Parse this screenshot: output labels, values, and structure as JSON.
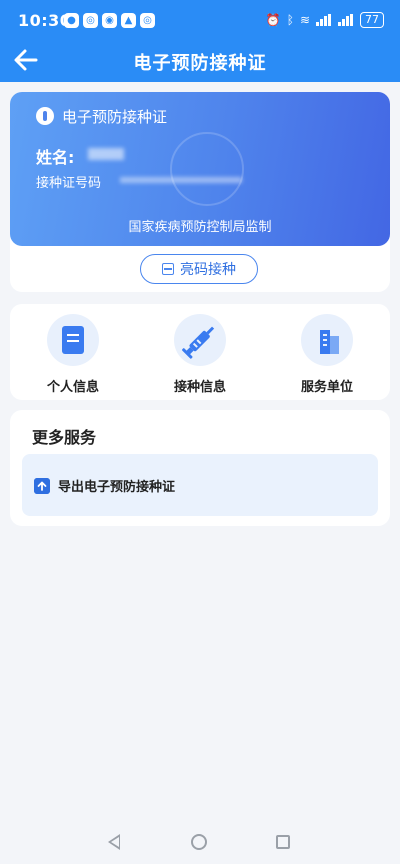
{
  "status_bar": {
    "time": "10:30",
    "battery": "77",
    "app_icons": [
      "app-icon-1",
      "app-icon-2",
      "app-icon-3",
      "app-icon-4",
      "app-icon-5"
    ],
    "system_icons": [
      "alarm-icon",
      "bluetooth-icon",
      "wifi-icon",
      "signal-icon",
      "signal-icon",
      "battery-icon"
    ]
  },
  "header": {
    "title": "电子预防接种证",
    "back_icon": "arrow-left-icon"
  },
  "certificate": {
    "title": "电子预防接种证",
    "name_label": "姓名:",
    "id_label": "接种证号码",
    "footer": "国家疾病预防控制局监制",
    "show_code_button": "亮码接种"
  },
  "quick_actions": [
    {
      "label": "个人信息",
      "icon": "document-icon"
    },
    {
      "label": "接种信息",
      "icon": "syringe-icon"
    },
    {
      "label": "服务单位",
      "icon": "building-icon"
    }
  ],
  "more_services": {
    "title": "更多服务",
    "items": [
      {
        "label": "导出电子预防接种证",
        "icon": "upload-icon"
      }
    ]
  },
  "colors": {
    "primary": "#2a8cf6",
    "card_gradient_start": "#5ea0f5",
    "card_gradient_end": "#4367e4",
    "accent": "#2f6fe0",
    "background": "#f3f5f9"
  }
}
